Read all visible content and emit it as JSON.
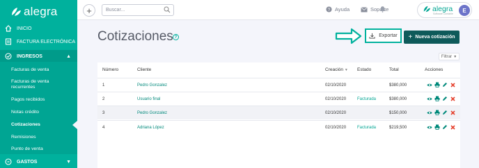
{
  "app": {
    "brand": "alegra"
  },
  "sidebar": {
    "inicio": "INICIO",
    "factura": "FACTURA ELECTRÓNICA",
    "ingresos": "INGRESOS",
    "items": [
      "Facturas de venta",
      "Facturas de venta recurrentes",
      "Pagos recibidos",
      "Notas crédito",
      "Cotizaciones",
      "Remisiones",
      "Punto de venta"
    ],
    "active_item": "Cotizaciones",
    "gastos": "GASTOS"
  },
  "topbar": {
    "search_placeholder": "Buscar...",
    "help": "Ayuda",
    "support": "Soporte",
    "account_brand": "alegra",
    "account_tagline": "Software Contable",
    "avatar_initial": "E"
  },
  "page": {
    "title": "Cotizaciones",
    "export_label": "Exportar",
    "new_label": "Nueva cotización",
    "filter_label": "Filtrar"
  },
  "table": {
    "headers": {
      "number": "Número",
      "client": "Cliente",
      "created": "Creación",
      "status": "Estado",
      "total": "Total",
      "actions": "Acciones"
    },
    "rows": [
      {
        "number": "1",
        "client": "Pedro Gonzalez",
        "created": "02/10/2020",
        "status": "",
        "total": "$380,000"
      },
      {
        "number": "2",
        "client": "Usuario final",
        "created": "02/10/2020",
        "status": "Facturada",
        "total": "$380,000"
      },
      {
        "number": "3",
        "client": "Pedro Gonzalez",
        "created": "02/10/2020",
        "status": "",
        "total": "$150,000"
      },
      {
        "number": "4",
        "client": "Adriana López",
        "created": "02/10/2020",
        "status": "Facturada",
        "total": "$219,500"
      }
    ]
  },
  "colors": {
    "brand": "#00b19d",
    "primary_dark": "#0e5a5a",
    "delete": "#e5432f"
  },
  "icons": [
    "home-icon",
    "invoice-icon",
    "ingresos-icon",
    "gastos-icon",
    "search-icon",
    "help-icon",
    "mail-icon",
    "bell-icon",
    "arrow-right-icon",
    "download-icon",
    "plus-icon",
    "eye-icon",
    "print-icon",
    "edit-icon",
    "delete-icon"
  ]
}
